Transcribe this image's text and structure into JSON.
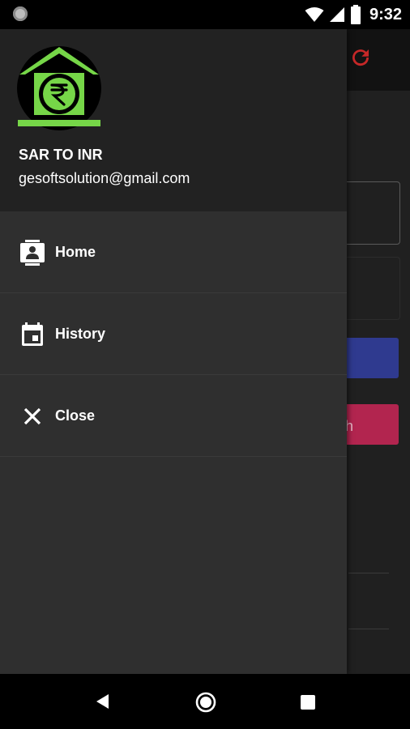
{
  "status_bar": {
    "time": "9:32",
    "icons": [
      "notification-dot-icon",
      "wifi-icon",
      "cell-signal-icon",
      "battery-icon"
    ]
  },
  "background_app": {
    "refresh_icon": "refresh-icon",
    "button_partial_text": "h"
  },
  "drawer": {
    "logo_icon": "rupee-house-logo-icon",
    "app_name": "SAR TO INR",
    "email": "gesoftsolution@gmail.com",
    "items": [
      {
        "label": "Home",
        "icon": "contact-card-icon"
      },
      {
        "label": "History",
        "icon": "calendar-icon"
      },
      {
        "label": "Close",
        "icon": "close-icon"
      }
    ]
  },
  "nav_bar": {
    "icons": [
      "back-icon",
      "home-icon",
      "recent-apps-icon"
    ]
  },
  "colors": {
    "accent_green": "#76d648",
    "refresh_red": "#c62828",
    "primary_blue": "#2f3a8f",
    "secondary_pink": "#b2254f"
  }
}
